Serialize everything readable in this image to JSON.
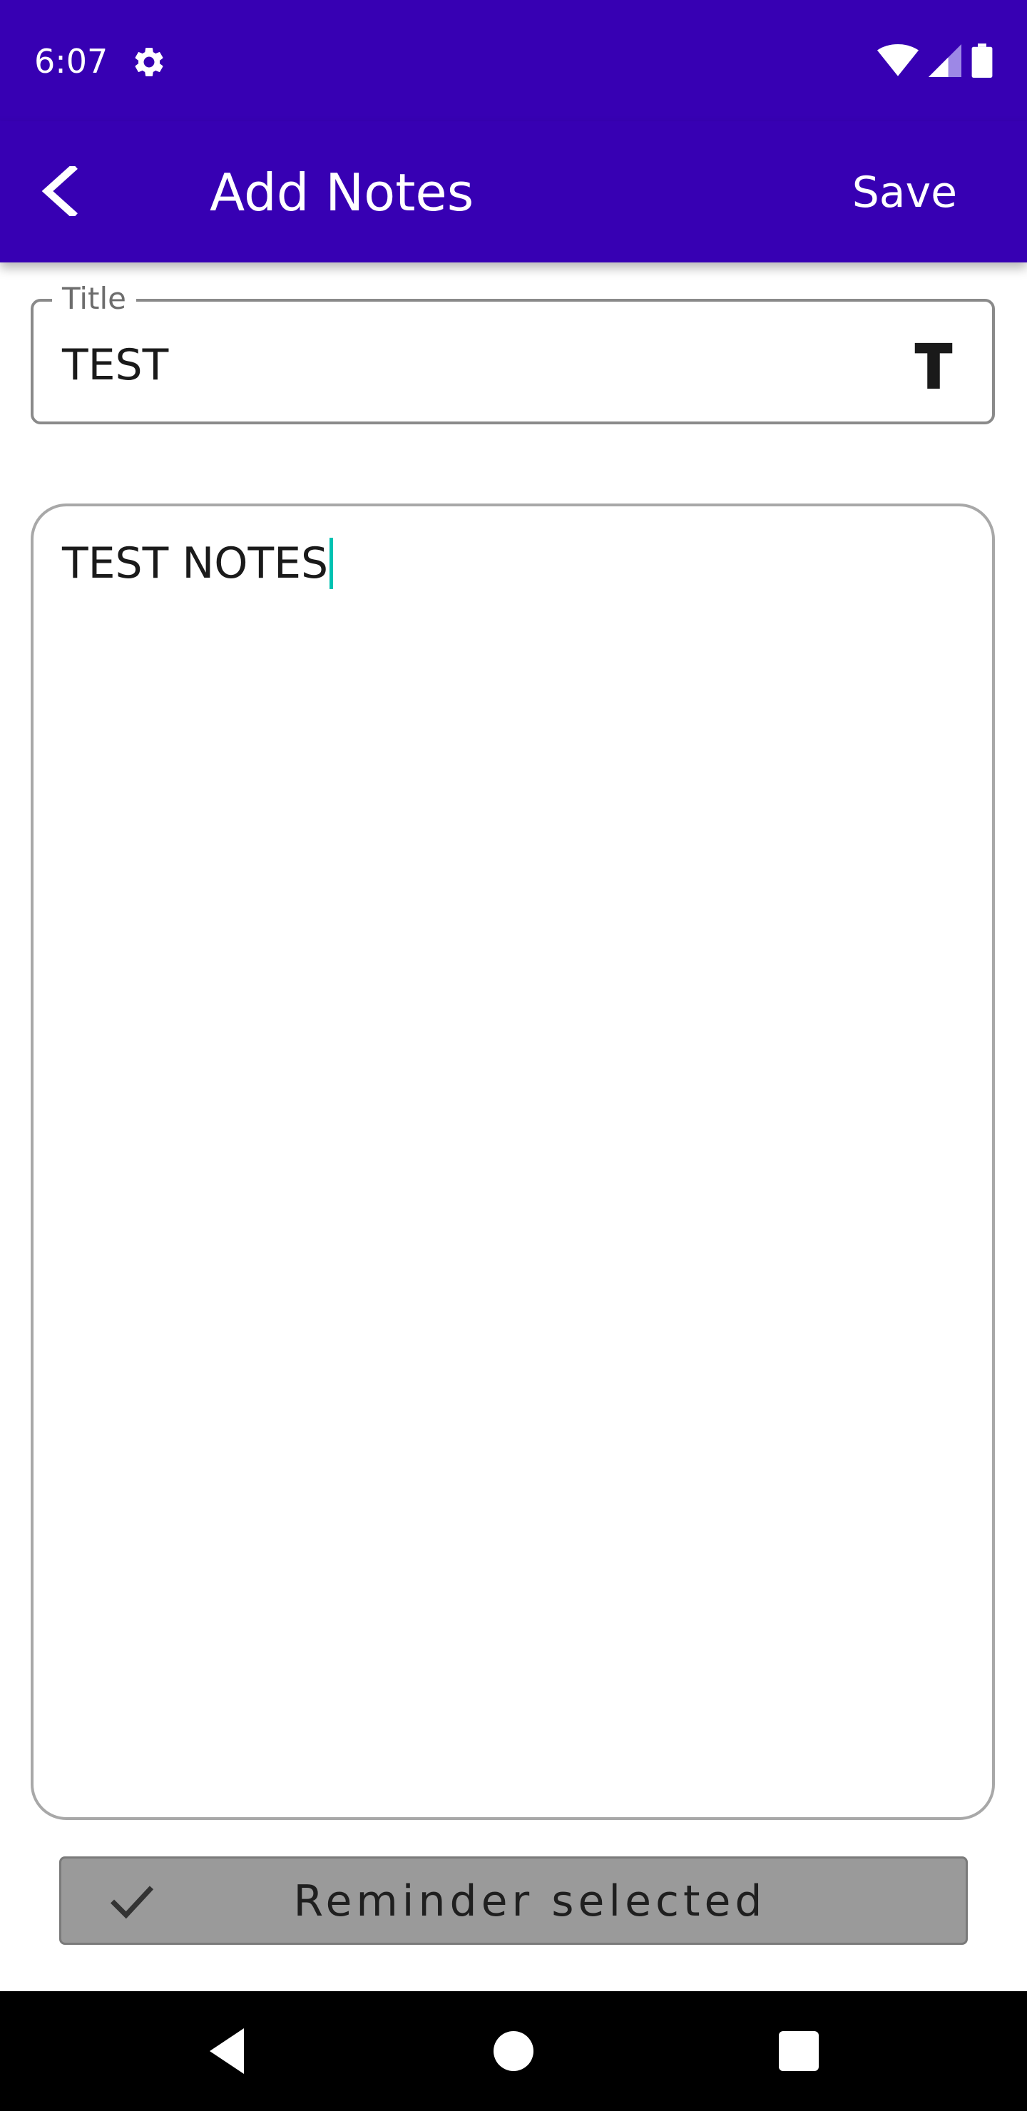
{
  "status_bar": {
    "time": "6:07",
    "icons": [
      "settings-gear-icon",
      "wifi-icon",
      "cell-signal-icon",
      "battery-icon"
    ]
  },
  "app_bar": {
    "back_icon": "chevron-left-icon",
    "title": "Add Notes",
    "save_label": "Save"
  },
  "title_field": {
    "label": "Title",
    "value": "TEST",
    "trailing_icon": "text-format-icon"
  },
  "notes_field": {
    "value": "TEST NOTES"
  },
  "reminder_button": {
    "icon": "checkmark-icon",
    "label": "Reminder selected"
  },
  "nav_bar": {
    "icons": [
      "back-triangle-icon",
      "home-circle-icon",
      "recents-square-icon"
    ]
  },
  "colors": {
    "primary": "#3700b3",
    "caret": "#00c2b2",
    "button_bg": "#9a9a9a",
    "nav_bg": "#000000"
  }
}
